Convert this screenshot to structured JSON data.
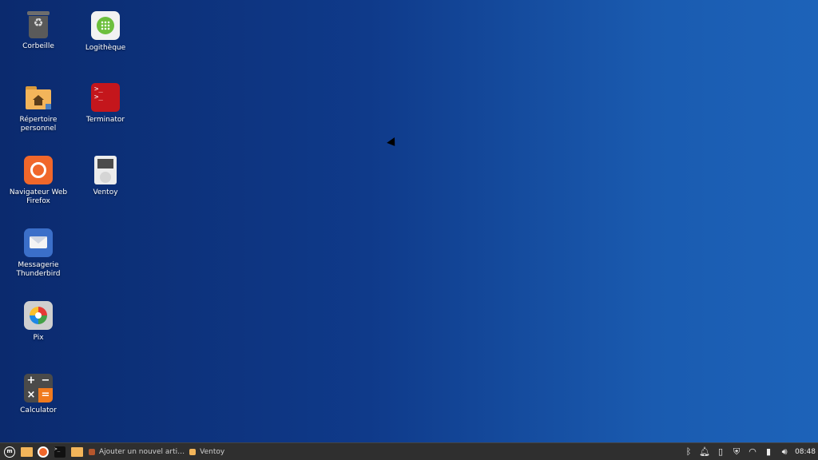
{
  "desktop": {
    "icons": [
      {
        "label": "Corbeille"
      },
      {
        "label": "Logithèque"
      },
      {
        "label": "Répertoire personnel"
      },
      {
        "label": "Terminator"
      },
      {
        "label": "Navigateur Web Firefox"
      },
      {
        "label": "Ventoy"
      },
      {
        "label": "Messagerie Thunderbird"
      },
      {
        "label": "Pix"
      },
      {
        "label": "Calculator"
      }
    ]
  },
  "taskbar": {
    "windows": [
      {
        "label": "Ajouter un nouvel arti…",
        "icon": "firefox-icon"
      },
      {
        "label": "Ventoy",
        "icon": "folder-icon"
      }
    ],
    "tray_icons": [
      "bluetooth-icon",
      "notifications-icon",
      "clipboard-icon",
      "update-shield-icon",
      "wifi-icon",
      "battery-icon",
      "volume-icon"
    ],
    "clock": "08:48"
  },
  "colors": {
    "wallpaper_left": "#0b2a6e",
    "wallpaper_right": "#1d63b9",
    "panel": "#2f2f2f"
  }
}
